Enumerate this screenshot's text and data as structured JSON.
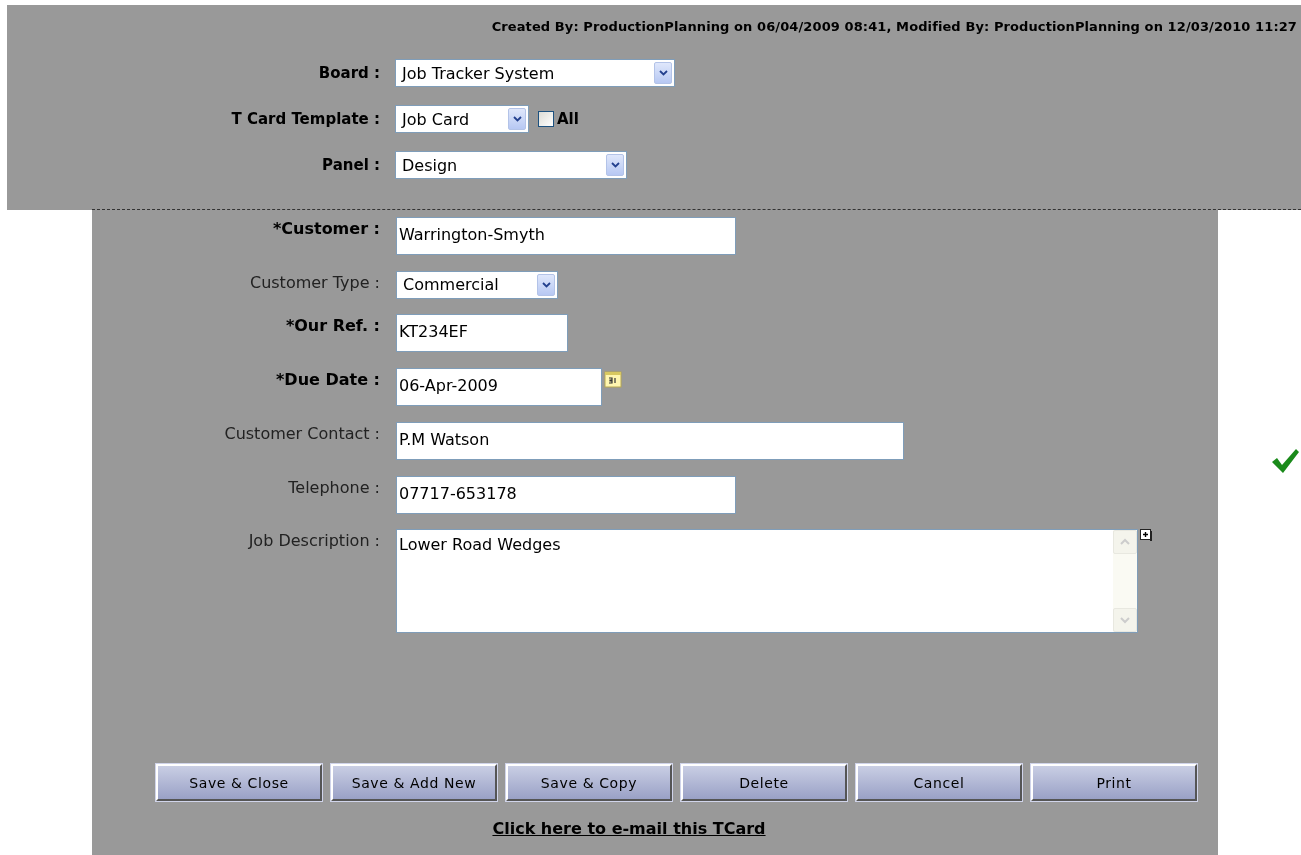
{
  "audit_line": "Created By: ProductionPlanning on 06/04/2009 08:41, Modified By: ProductionPlanning on 12/03/2010 11:27",
  "header_fields": [
    {
      "label": "Board :",
      "kind": "select",
      "value": "Job Tracker System"
    },
    {
      "label": "T Card Template :",
      "kind": "select",
      "value": "Job Card",
      "checkbox": {
        "label": "All",
        "checked": false
      }
    },
    {
      "label": "Panel :",
      "kind": "select",
      "value": "Design"
    }
  ],
  "form_fields": [
    {
      "label": "*Customer :",
      "required": true,
      "kind": "text",
      "value": "Warrington-Smyth"
    },
    {
      "label": "Customer Type :",
      "required": false,
      "kind": "select",
      "value": "Commercial"
    },
    {
      "label": "*Our Ref. :",
      "required": true,
      "kind": "text",
      "value": "KT234EF"
    },
    {
      "label": "*Due Date :",
      "required": true,
      "kind": "date",
      "value": "06-Apr-2009"
    },
    {
      "label": "Customer Contact :",
      "required": false,
      "kind": "text",
      "value": "P.M Watson"
    },
    {
      "label": "Telephone :",
      "required": false,
      "kind": "text",
      "value": "07717-653178"
    },
    {
      "label": "Job Description :",
      "required": false,
      "kind": "textarea",
      "value": "Lower Road Wedges"
    }
  ],
  "buttons": [
    "Save & Close",
    "Save & Add New",
    "Save & Copy",
    "Delete",
    "Cancel",
    "Print"
  ],
  "email_link": "Click here to e-mail this TCard"
}
